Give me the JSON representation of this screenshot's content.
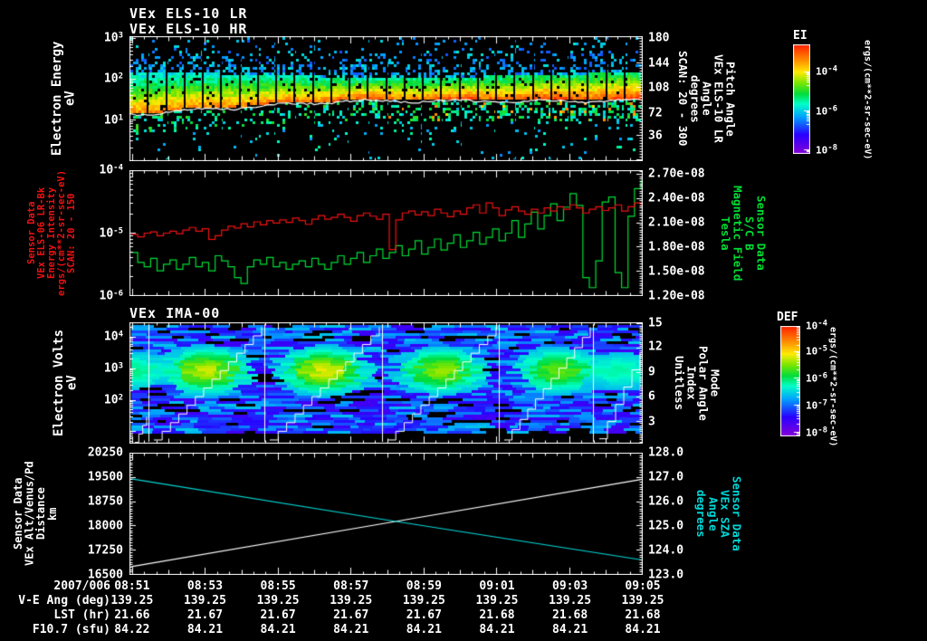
{
  "titles": {
    "els1": "VEx ELS-10 LR",
    "els2": "VEx ELS-10 HR",
    "ima": "VEx IMA-00"
  },
  "colors": {
    "background": "#000000",
    "frame": "#ffffff",
    "text": "#ffffff",
    "red_series": "#ee1111",
    "green_series": "#00dd33",
    "cyan_series": "#00d8d8",
    "white_series": "#ffffff"
  },
  "panel1": {
    "left_label_lines": [
      "Electron Energy",
      "eV"
    ],
    "left_ticks": [
      {
        "m": "10",
        "e": "3",
        "frac": 0.015
      },
      {
        "m": "10",
        "e": "2",
        "frac": 0.34
      },
      {
        "m": "10",
        "e": "1",
        "frac": 0.675
      }
    ],
    "right_ticks": [
      {
        "t": "180",
        "frac": 0.014
      },
      {
        "t": "144",
        "frac": 0.217
      },
      {
        "t": "108",
        "frac": 0.413
      },
      {
        "t": "72",
        "frac": 0.616
      },
      {
        "t": "36",
        "frac": 0.797
      }
    ],
    "right_label_lines": [
      "Pitch Angle",
      "VEx ELS-10 LR",
      "Angle",
      "degrees",
      "SCAN: 20 - 300"
    ]
  },
  "panel2": {
    "left_label_lines": [
      "Sensor Data",
      "VEx ELS-06 LR-Bk",
      "Energy Intensity",
      "ergs/(cm**2-sr-sec-eV)",
      "SCAN: 20 - 150"
    ],
    "left_ticks": [
      {
        "m": "10",
        "e": "-4",
        "frac": 0.0
      },
      {
        "m": "10",
        "e": "-5",
        "frac": 0.5
      },
      {
        "m": "10",
        "e": "-6",
        "frac": 1.0
      }
    ],
    "right_ticks": [
      {
        "t": "2.70e-08",
        "frac": 0.028
      },
      {
        "t": "2.40e-08",
        "frac": 0.222
      },
      {
        "t": "2.10e-08",
        "frac": 0.417
      },
      {
        "t": "1.80e-08",
        "frac": 0.611
      },
      {
        "t": "1.50e-08",
        "frac": 0.806
      },
      {
        "t": "1.20e-08",
        "frac": 1.0
      }
    ],
    "right_label_lines": [
      "Sensor Data",
      "S/C B",
      "Magnetic Field",
      "Tesla"
    ]
  },
  "panel3": {
    "left_label_lines": [
      "Electron Volts",
      "eV"
    ],
    "left_ticks": [
      {
        "m": "10",
        "e": "4",
        "frac": 0.119
      },
      {
        "m": "10",
        "e": "3",
        "frac": 0.381
      },
      {
        "m": "10",
        "e": "2",
        "frac": 0.642
      }
    ],
    "right_ticks": [
      {
        "t": "15",
        "frac": 0.01
      },
      {
        "t": "12",
        "frac": 0.205
      },
      {
        "t": "9",
        "frac": 0.41
      },
      {
        "t": "6",
        "frac": 0.615
      },
      {
        "t": "3",
        "frac": 0.82
      }
    ],
    "right_label_lines": [
      "Mode",
      "Polar Angle",
      "Index",
      "Unitless"
    ]
  },
  "panel4": {
    "left_label_lines": [
      "Sensor Data",
      "VEx Alt/Venus/Pd",
      "Distance",
      "km"
    ],
    "left_ticks": [
      {
        "t": "20250",
        "frac": 0.0
      },
      {
        "t": "19500",
        "frac": 0.2
      },
      {
        "t": "18750",
        "frac": 0.4
      },
      {
        "t": "18000",
        "frac": 0.6
      },
      {
        "t": "17250",
        "frac": 0.8
      },
      {
        "t": "16500",
        "frac": 1.0
      }
    ],
    "right_ticks": [
      {
        "t": "128.0",
        "frac": 0.0
      },
      {
        "t": "127.0",
        "frac": 0.2
      },
      {
        "t": "126.0",
        "frac": 0.4
      },
      {
        "t": "125.0",
        "frac": 0.6
      },
      {
        "t": "124.0",
        "frac": 0.8
      },
      {
        "t": "123.0",
        "frac": 1.0
      }
    ],
    "right_label_lines": [
      "Sensor Data",
      "VEx SZA",
      "Angle",
      "degrees"
    ]
  },
  "colorbars": {
    "ei": {
      "title": "EI",
      "ticks": [
        {
          "m": "10",
          "e": "-4",
          "frac": 0.25
        },
        {
          "m": "10",
          "e": "-6",
          "frac": 0.61
        },
        {
          "m": "10",
          "e": "-8",
          "frac": 0.97
        }
      ],
      "units": "ergs/(cm**2-sr-sec-eV)"
    },
    "def": {
      "title": "DEF",
      "ticks": [
        {
          "m": "10",
          "e": "-4",
          "frac": 0.0
        },
        {
          "m": "10",
          "e": "-5",
          "frac": 0.23
        },
        {
          "m": "10",
          "e": "-6",
          "frac": 0.475
        },
        {
          "m": "10",
          "e": "-7",
          "frac": 0.72
        },
        {
          "m": "10",
          "e": "-8",
          "frac": 0.967
        }
      ],
      "units": "ergs/(cm**2-sr-sec-eV)"
    },
    "gradient_stops": [
      "#8800d4",
      "#2800ff",
      "#00a0ff",
      "#00ffc8",
      "#00dc3c",
      "#78e600",
      "#ffeb00",
      "#ff8c00",
      "#ff1e00"
    ]
  },
  "bottom": {
    "date": "2007/006",
    "row_labels": [
      "V-E Ang (deg)",
      "LST (hr)",
      "F10.7 (sfu)"
    ],
    "times": [
      "08:51",
      "08:53",
      "08:55",
      "08:57",
      "08:59",
      "09:01",
      "09:03",
      "09:05"
    ],
    "time_fracs": [
      0.005,
      0.1472,
      0.2894,
      0.4316,
      0.5738,
      0.716,
      0.8582,
      1.0
    ],
    "ve_ang": [
      "139.25",
      "139.25",
      "139.25",
      "139.25",
      "139.25",
      "139.25",
      "139.25",
      "139.25"
    ],
    "lst": [
      "21.66",
      "21.67",
      "21.67",
      "21.67",
      "21.67",
      "21.68",
      "21.68",
      "21.68"
    ],
    "f107": [
      "84.22",
      "84.21",
      "84.21",
      "84.21",
      "84.21",
      "84.21",
      "84.21",
      "84.21"
    ]
  },
  "chart_data": [
    {
      "type": "heatmap",
      "name": "els_pitch_angle_spectrogram",
      "title": "VEx ELS-10 LR / VEx ELS-10 HR",
      "xlabel": "UT 08:51 - 09:05 (2007/006)",
      "ylabel": "Electron Energy (eV), log 10^0 - 10^3",
      "zlabel": "EI ergs/(cm**2-sr-sec-eV), 10^-8 - 10^-4",
      "legend_position": "right-colorbar",
      "seed": 20070061,
      "scan_blocks": 28,
      "band_top_frac": 0.315,
      "white_line_frac_start": 0.625,
      "white_line_frac_end": 0.52,
      "features": "dense green-yellow-orange flux band between ~20-200 eV, white mean-energy trace along band bottom, scattered blue/cyan counts above and below, intensity reddens toward 09:05"
    },
    {
      "type": "line",
      "name": "energy_intensity_and_magnetic_field",
      "x_range": [
        "08:51",
        "09:05"
      ],
      "left_axis": {
        "label": "Energy Intensity ergs/(cm**2-sr-sec-eV)",
        "scale": "log",
        "min_exp": -6,
        "max_exp": -4
      },
      "right_axis": {
        "label": "Magnetic Field (Tesla)",
        "scale": "linear",
        "min": 1.2e-08,
        "max": 2.7e-08
      },
      "series": [
        {
          "name": "ELS-06 energy intensity (log10)",
          "color": "#ee1111",
          "axis": "left",
          "values": [
            -5.02,
            -5.06,
            -5.0,
            -4.98,
            -5.04,
            -5.0,
            -4.97,
            -5.01,
            -4.95,
            -4.91,
            -4.97,
            -4.93,
            -5.1,
            -5.04,
            -4.95,
            -4.89,
            -4.92,
            -4.85,
            -4.9,
            -4.82,
            -4.87,
            -4.8,
            -4.84,
            -4.79,
            -4.83,
            -4.76,
            -4.8,
            -4.86,
            -4.78,
            -4.72,
            -4.78,
            -4.75,
            -4.7,
            -4.75,
            -4.81,
            -4.72,
            -4.68,
            -4.73,
            -4.78,
            -4.7,
            -5.26,
            -4.79,
            -4.68,
            -4.65,
            -4.71,
            -4.66,
            -4.72,
            -4.62,
            -4.68,
            -4.74,
            -4.65,
            -4.7,
            -4.6,
            -4.55,
            -4.68,
            -4.52,
            -4.6,
            -4.72,
            -4.63,
            -4.58,
            -4.65,
            -4.7,
            -4.62,
            -4.68,
            -4.6,
            -4.65,
            -4.58,
            -4.62,
            -4.55,
            -4.6,
            -4.68,
            -4.62,
            -4.58,
            -4.64,
            -4.6,
            -4.55,
            -4.65,
            -4.58,
            -4.52,
            -4.58
          ]
        },
        {
          "name": "S/C B magnetic field (1e-8 Tesla)",
          "color": "#00dd33",
          "axis": "right",
          "values": [
            1.72,
            1.6,
            1.55,
            1.65,
            1.5,
            1.58,
            1.63,
            1.52,
            1.58,
            1.66,
            1.55,
            1.6,
            1.5,
            1.68,
            1.62,
            1.55,
            1.42,
            1.35,
            1.55,
            1.63,
            1.58,
            1.66,
            1.55,
            1.6,
            1.52,
            1.58,
            1.62,
            1.55,
            1.65,
            1.58,
            1.52,
            1.6,
            1.68,
            1.58,
            1.65,
            1.72,
            1.6,
            1.68,
            1.76,
            1.65,
            1.72,
            1.8,
            1.68,
            1.76,
            1.86,
            1.7,
            1.78,
            1.88,
            1.75,
            1.83,
            1.93,
            1.78,
            1.86,
            1.96,
            1.82,
            1.9,
            2.0,
            1.86,
            1.95,
            2.1,
            1.9,
            2.06,
            2.2,
            2.0,
            2.16,
            2.3,
            2.1,
            2.26,
            2.42,
            2.28,
            1.42,
            1.3,
            1.62,
            2.32,
            2.38,
            1.48,
            1.3,
            2.15,
            2.48,
            2.58
          ]
        }
      ]
    },
    {
      "type": "heatmap",
      "name": "ima_ion_spectrogram",
      "title": "VEx IMA-00",
      "xlabel": "UT 08:51 - 09:05 (2007/006)",
      "ylabel": "Electron Volts (eV), log ~10^1.5 - 10^4.5",
      "zlabel": "DEF ergs/(cm**2-sr-sec-eV), 10^-8 - 10^-4",
      "seed": 20070062,
      "divider_fracs": [
        0.037,
        0.263,
        0.492,
        0.72,
        0.903
      ],
      "blob_centers_frac": [
        0.15,
        0.379,
        0.608,
        0.836
      ],
      "blob_strengths": [
        1.0,
        1.05,
        0.9,
        0.8
      ],
      "blob_y_frac": 0.4,
      "features": "four scan segments of blue striped ion counts, bright green-yellow blob near 1 keV in each, white staircase polar-angle index trace rising through each segment"
    },
    {
      "type": "line",
      "name": "altitude_and_sza",
      "x_range": [
        "08:51",
        "09:05"
      ],
      "left_axis": {
        "label": "VEx Alt/Venus/Pd Distance (km)",
        "min": 16500,
        "max": 20250
      },
      "right_axis": {
        "label": "VEx SZA (degrees)",
        "min": 123.0,
        "max": 128.0
      },
      "series": [
        {
          "name": "distance km",
          "color": "#ffffff",
          "axis": "left",
          "x": [
            0,
            0.5,
            1
          ],
          "values": [
            16755,
            18090,
            19425
          ]
        },
        {
          "name": "solar zenith angle deg",
          "color": "#00d8d8",
          "axis": "right",
          "x": [
            0,
            0.5,
            1
          ],
          "values": [
            126.93,
            125.25,
            123.62
          ]
        }
      ]
    }
  ]
}
